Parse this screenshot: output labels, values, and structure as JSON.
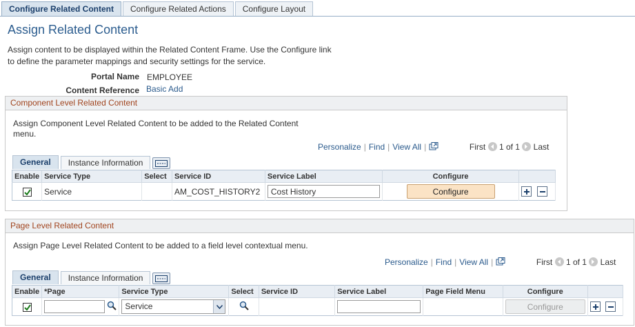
{
  "tabs": [
    {
      "label": "Configure Related Content",
      "active": true
    },
    {
      "label": "Configure Related Actions",
      "active": false
    },
    {
      "label": "Configure Layout",
      "active": false
    }
  ],
  "page": {
    "title": "Assign Related Content",
    "intro": "Assign content to be displayed within the Related Content Frame. Use the Configure link to define the parameter mappings and security settings for the service.",
    "portal_name_label": "Portal Name",
    "portal_name_value": "EMPLOYEE",
    "content_ref_label": "Content Reference",
    "content_ref_value": "Basic Add"
  },
  "component_group": {
    "header": "Component Level Related Content",
    "description": "Assign Component Level Related Content to be added to the Related Content menu.",
    "nav": {
      "personalize": "Personalize",
      "find": "Find",
      "view_all": "View All",
      "first": "First",
      "range": "1 of 1",
      "last": "Last"
    },
    "grid_tabs": [
      "General",
      "Instance Information"
    ],
    "columns": [
      "Enable",
      "Service Type",
      "Select",
      "Service ID",
      "Service Label",
      "Configure"
    ],
    "row": {
      "enabled": true,
      "service_type": "Service",
      "service_id": "AM_COST_HISTORY2",
      "service_label": "Cost History",
      "configure": "Configure"
    }
  },
  "page_group": {
    "header": "Page Level Related Content",
    "description": "Assign Page Level Related Content to be added to a field level contextual menu.",
    "nav": {
      "personalize": "Personalize",
      "find": "Find",
      "view_all": "View All",
      "first": "First",
      "range": "1 of 1",
      "last": "Last"
    },
    "grid_tabs": [
      "General",
      "Instance Information"
    ],
    "columns": [
      "Enable",
      "*Page",
      "Service Type",
      "Select",
      "Service ID",
      "Service Label",
      "Page Field Menu",
      "Configure"
    ],
    "row": {
      "enabled": true,
      "page": "",
      "service_type": "Service",
      "service_id": "",
      "service_label": "",
      "page_field_menu": "",
      "configure": "Configure"
    }
  },
  "icons": {
    "zoom": "zoom-icon",
    "prev": "prev-arrow-icon",
    "next": "next-arrow-icon",
    "add": "add-row-icon",
    "delete": "delete-row-icon",
    "show_all_columns": "show-all-columns-icon",
    "lookup": "lookup-magnifier-icon"
  },
  "colors": {
    "title": "#2c5d8f",
    "group_header": "#a0431d",
    "link": "#2a5a8c",
    "button": "#fbe3c5"
  }
}
